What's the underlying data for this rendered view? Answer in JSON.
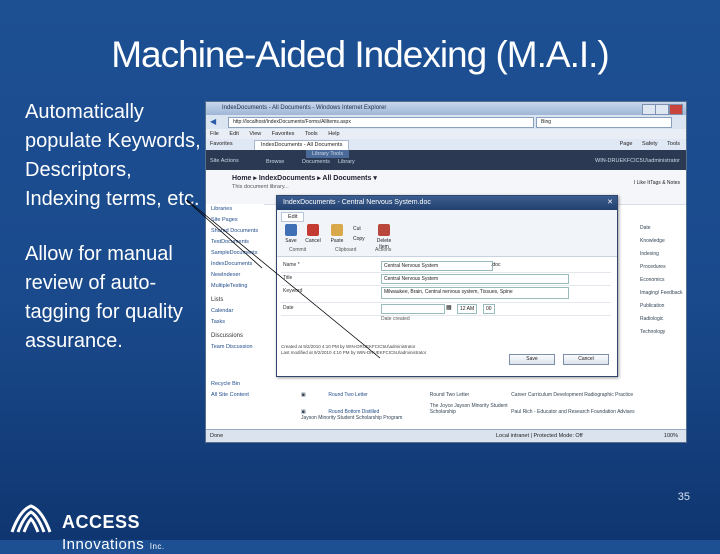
{
  "slide": {
    "title": "Machine-Aided Indexing (M.A.I.)",
    "bullets": [
      "Automatically populate Keywords, Descriptors, Indexing terms, etc.",
      "Allow for manual review of auto-tagging for quality assurance."
    ],
    "slide_number": "35",
    "logo": {
      "access": "ACCESS",
      "innovations": "Innovations",
      "inc": "Inc."
    }
  },
  "browser": {
    "title": "IndexDocuments - All Documents - Windows Internet Explorer",
    "address": "http://localhost/IndexDocuments/Forms/AllItems.aspx",
    "search": "Bing",
    "menu": [
      "File",
      "Edit",
      "View",
      "Favorites",
      "Tools",
      "Help"
    ],
    "favorites_label": "Favorites",
    "tab_label": "IndexDocuments - All Documents",
    "tools": [
      "Page",
      "Safety",
      "Tools"
    ],
    "status_left": "Done",
    "zone": "Local intranet | Protected Mode: Off",
    "zoom": "100%"
  },
  "sharepoint": {
    "site_actions": "Site Actions",
    "tabs": [
      "Browse",
      "Documents",
      "Library"
    ],
    "library_tools": "Library Tools",
    "user": "WIN-DRUEKFCIC5U\\administrator",
    "breadcrumb": "Home ▸ IndexDocuments ▸ All Documents ▾",
    "breadcrumb_sub": "This document library...",
    "like_it": "I Like It",
    "tags_notes": "Tags & Notes",
    "nav": [
      "Libraries",
      "Site Pages",
      "Shared Documents",
      "TestDocuments",
      "SampleDocuments",
      "IndexDocuments",
      "NewIndexer",
      "MultipleTesting"
    ],
    "nav_sections": [
      "Lists",
      "Calendar",
      "Tasks",
      "Discussions",
      "Team Discussion"
    ],
    "nav_bottom": [
      "Recycle Bin",
      "All Site Content"
    ],
    "right_col": [
      "Date",
      "Knowledge Indexing",
      "Procedures",
      "Economics",
      "Imaging/ Feedback",
      "Publication",
      "Radiologic Technology"
    ],
    "list_rows": [
      {
        "name": "Round Two Letter",
        "desc": "Round Two Letter",
        "note": "Career Curriculum Development Radiographic Practice"
      },
      {
        "name": "Round Bottom Distilled",
        "desc": "The Joyce Jayson Minority Student Scholarship",
        "note": "Paul Rich - Educator and Research Foundation Advises Jayson Minority Student Scholarship Program"
      }
    ]
  },
  "dialog": {
    "title": "IndexDocuments - Central Nervous System.doc",
    "close": "✕",
    "edit_tab": "Edit",
    "ribbon_buttons": [
      "Save",
      "Cancel",
      "Paste",
      "Delete Item"
    ],
    "ribbon_small": [
      "Cut",
      "Copy"
    ],
    "ribbon_groups": [
      "Commit",
      "Clipboard",
      "Actions"
    ],
    "fields": {
      "name_label": "Name *",
      "name_value": "Central Nervous System",
      "name_suffix": ".doc",
      "title_label": "Title",
      "title_value": "Central Nervous System",
      "keyword_label": "Keyword",
      "keyword_value": "Milwaukee, Brain, Central nervous system, Tissues, Spine",
      "date_label": "Date",
      "date_hour": "12 AM",
      "date_min": "00",
      "date_created_label": "Date created"
    },
    "created_line": "Created at 9/2/2010 4:10 PM by WIN-DRUEKFCIC5U\\administrator",
    "modified_line": "Last modified at 9/2/2010 4:10 PM by WIN-DRUEKFCIC5U\\administrator",
    "save_label": "Save",
    "cancel_label": "Cancel"
  },
  "colors": {
    "slide_bg": "#1a4a8c",
    "title_text": "#ffffff",
    "dialog_titlebar": "#23416f"
  }
}
